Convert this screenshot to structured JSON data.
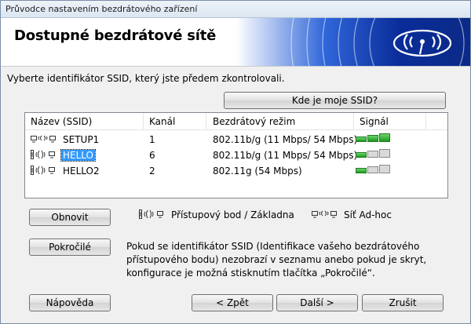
{
  "window": {
    "title": "Průvodce nastavením bezdrátového zařízení"
  },
  "header": {
    "title": "Dostupné bezdrátové sítě"
  },
  "instruction": "Vyberte identifikátor SSID, který jste předem zkontrolovali.",
  "where_ssid_button": "Kde je moje SSID?",
  "table": {
    "columns": [
      "Název (SSID)",
      "Kanál",
      "Bezdrátový režim",
      "Signál"
    ],
    "rows": [
      {
        "type": "adhoc",
        "ssid": "SETUP1",
        "channel": "1",
        "mode": "802.11b/g (11 Mbps/ 54 Mbps)",
        "signal": 3,
        "selected": false
      },
      {
        "type": "ap",
        "ssid": "HELLO",
        "channel": "6",
        "mode": "802.11b/g (11 Mbps/ 54 Mbps)",
        "signal": 1,
        "selected": true
      },
      {
        "type": "ap",
        "ssid": "HELLO2",
        "channel": "2",
        "mode": "802.11g (54 Mbps)",
        "signal": 1,
        "selected": false
      }
    ]
  },
  "refresh_button": "Obnovit",
  "legend": {
    "ap": "Přístupový bod / Základna",
    "adhoc": "Síť Ad-hoc"
  },
  "advanced_button": "Pokročilé",
  "advanced_info": [
    "Pokud se identifikátor SSID (Identifikace vašeho bezdrátového",
    "přístupového bodu) nezobrazí v seznamu anebo pokud je skryt,",
    "konfigurace je možná stisknutím tlačítka „Pokročilé“."
  ],
  "footer": {
    "help": "Nápověda",
    "back": "< Zpět",
    "next": "Další >",
    "cancel": "Zrušit"
  },
  "signal_levels": 3,
  "colors": {
    "signal_on": "#2ea52e",
    "selection": "#3399ff",
    "banner_dark": "#0b2a86"
  },
  "icons": {
    "ap": "access-point-icon",
    "adhoc": "adhoc-icon",
    "logo": "wireless-logo-icon"
  }
}
